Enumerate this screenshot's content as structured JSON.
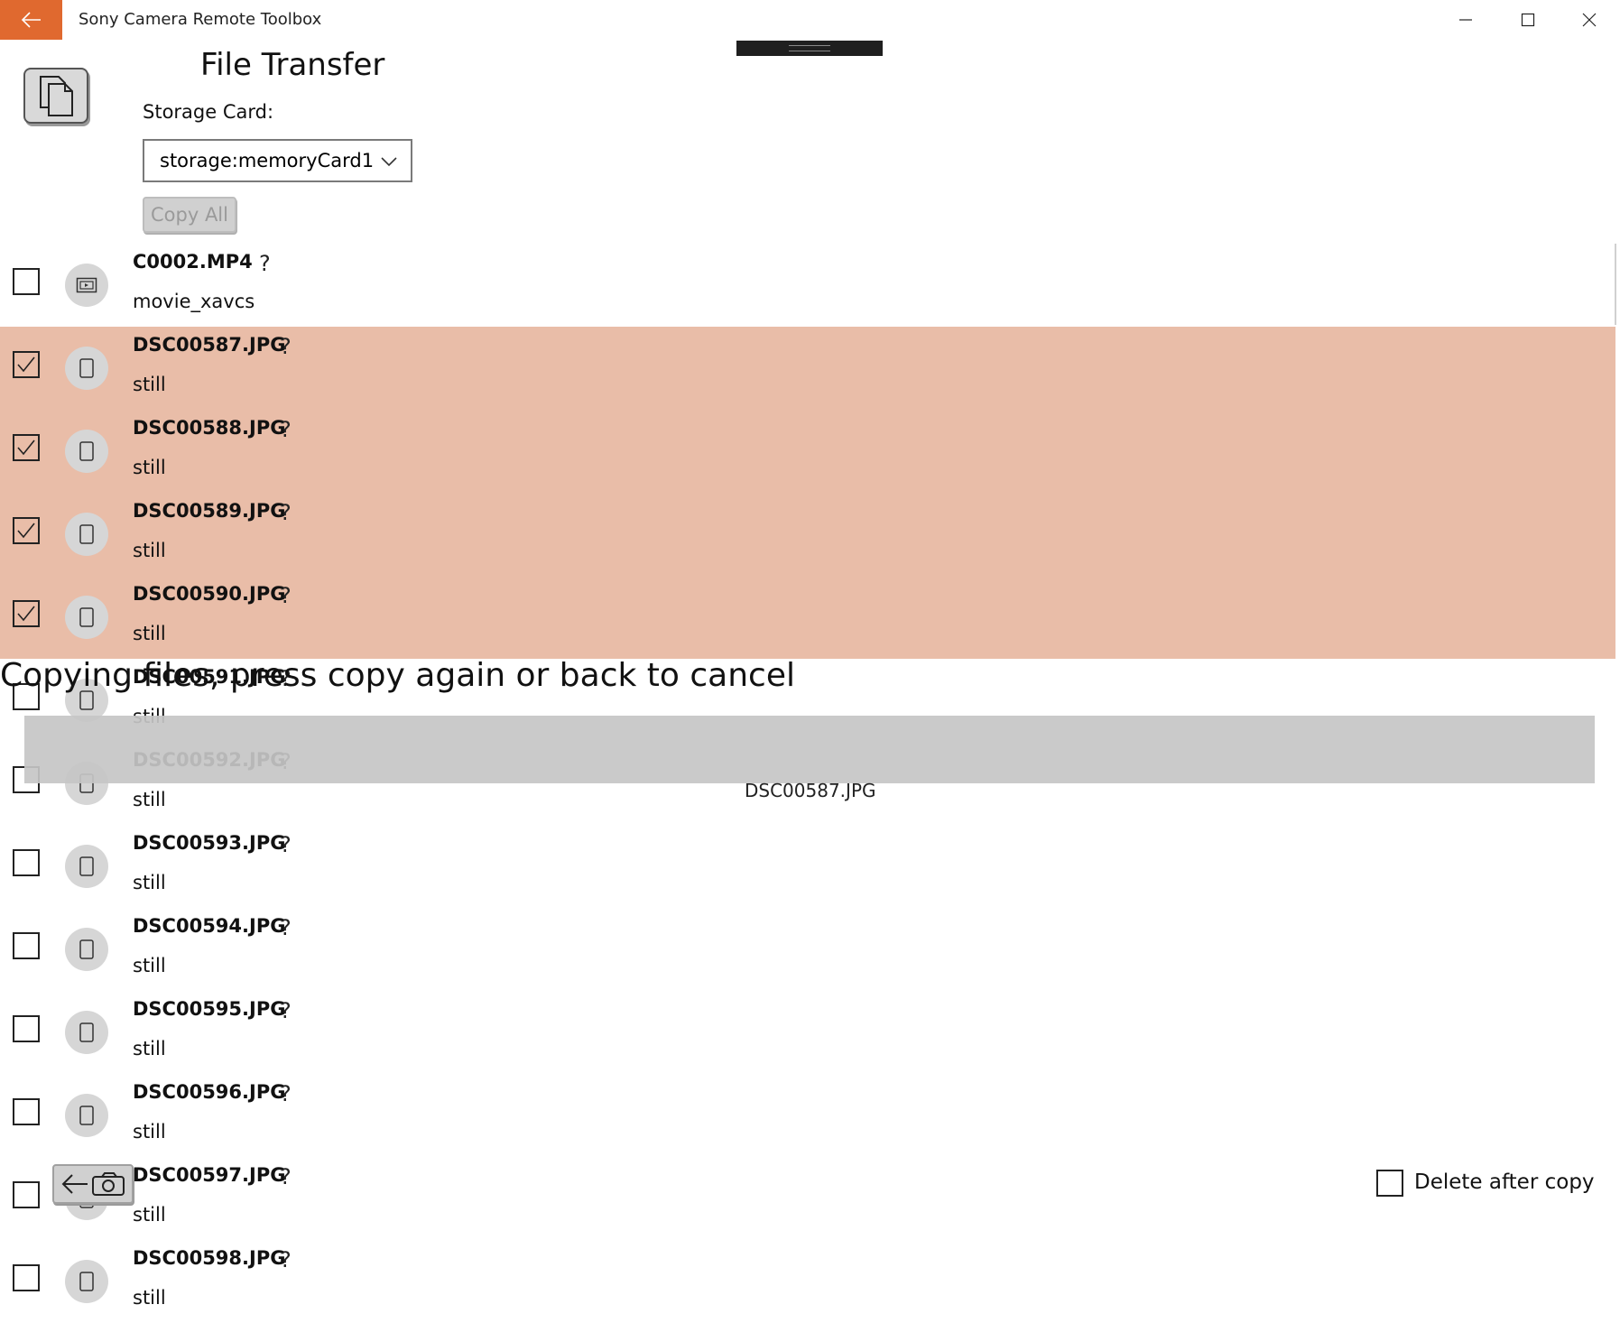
{
  "window": {
    "title": "Sony Camera Remote Toolbox",
    "accent": "#e0692f",
    "controls": {
      "minimize": "minimize-icon",
      "maximize": "maximize-icon",
      "close": "close-icon"
    }
  },
  "header": {
    "page_title": "File Transfer",
    "storage_label": "Storage Card:",
    "storage_value": "storage:memoryCard1",
    "copy_all_label": "Copy All"
  },
  "files": [
    {
      "name": "C0002.MP4",
      "type": "movie_xavcs",
      "checked": false,
      "icon": "movie-icon",
      "status": "?"
    },
    {
      "name": "DSC00587.JPG",
      "type": "still",
      "checked": true,
      "icon": "photo-icon",
      "status": "?"
    },
    {
      "name": "DSC00588.JPG",
      "type": "still",
      "checked": true,
      "icon": "photo-icon",
      "status": "?"
    },
    {
      "name": "DSC00589.JPG",
      "type": "still",
      "checked": true,
      "icon": "photo-icon",
      "status": "?"
    },
    {
      "name": "DSC00590.JPG",
      "type": "still",
      "checked": true,
      "icon": "photo-icon",
      "status": "?"
    },
    {
      "name": "DSC00591.JPG",
      "type": "still",
      "checked": false,
      "icon": "photo-icon",
      "status": "?"
    },
    {
      "name": "DSC00592.JPG",
      "type": "still",
      "checked": false,
      "icon": "photo-icon",
      "status": "?"
    },
    {
      "name": "DSC00593.JPG",
      "type": "still",
      "checked": false,
      "icon": "photo-icon",
      "status": "?"
    },
    {
      "name": "DSC00594.JPG",
      "type": "still",
      "checked": false,
      "icon": "photo-icon",
      "status": "?"
    },
    {
      "name": "DSC00595.JPG",
      "type": "still",
      "checked": false,
      "icon": "photo-icon",
      "status": "?"
    },
    {
      "name": "DSC00596.JPG",
      "type": "still",
      "checked": false,
      "icon": "photo-icon",
      "status": "?"
    },
    {
      "name": "DSC00597.JPG",
      "type": "still",
      "checked": false,
      "icon": "photo-icon",
      "status": "?"
    },
    {
      "name": "DSC00598.JPG",
      "type": "still",
      "checked": false,
      "icon": "photo-icon",
      "status": "?"
    }
  ],
  "copy_status": {
    "message": "Copying files, press copy again or back to cancel",
    "current_file": "DSC00587.JPG"
  },
  "footer": {
    "delete_after_copy_label": "Delete after copy",
    "delete_after_copy_checked": false
  }
}
